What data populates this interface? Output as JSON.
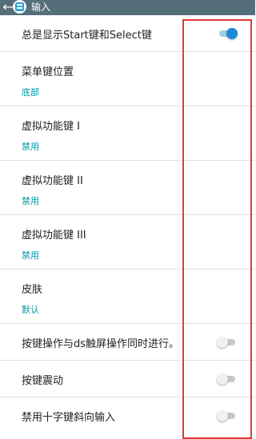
{
  "topbar": {
    "title": "输入",
    "back_icon": "arrow-left-icon",
    "app_icon": "gamepad-icon",
    "color": "#546e7a"
  },
  "settings": [
    {
      "label": "总是显示Start键和Select键",
      "type": "toggle",
      "on": true
    },
    {
      "label": "菜单键位置",
      "value": "底部",
      "type": "option"
    },
    {
      "label": "虚拟功能键 I",
      "value": "禁用",
      "type": "option"
    },
    {
      "label": "虚拟功能键 II",
      "value": "禁用",
      "type": "option"
    },
    {
      "label": "虚拟功能键 III",
      "value": "禁用",
      "type": "option"
    },
    {
      "label": "皮肤",
      "value": "默认",
      "type": "option"
    },
    {
      "label": "按键操作与ds触屏操作同时进行。",
      "type": "toggle",
      "on": false
    },
    {
      "label": "按键震动",
      "type": "toggle",
      "on": false
    },
    {
      "label": "禁用十字键斜向输入",
      "type": "toggle",
      "on": false
    }
  ],
  "colors": {
    "accent": "#1e88d8",
    "value_text": "#0097a7",
    "highlight_box": "#e53935"
  }
}
